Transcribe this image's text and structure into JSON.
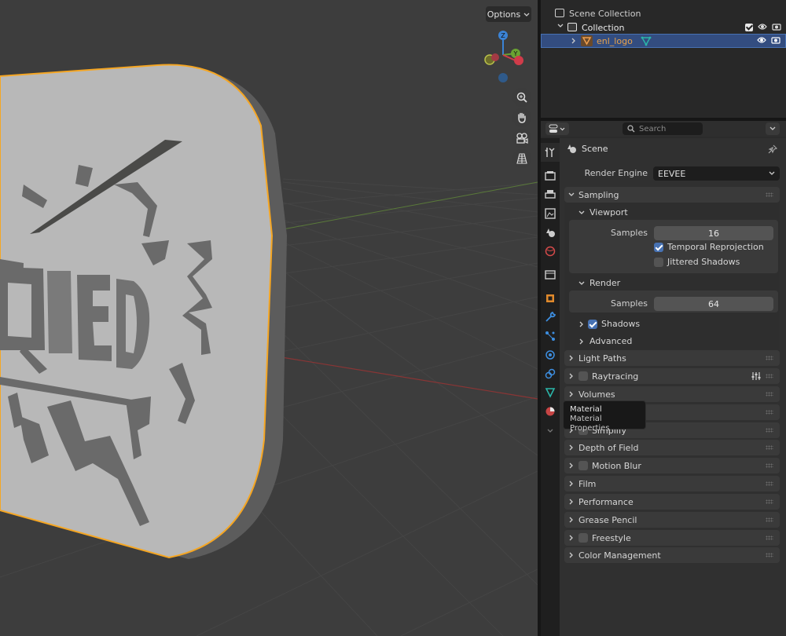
{
  "viewport": {
    "options_label": "Options",
    "gizmo_axes": [
      "Z",
      "Y"
    ],
    "logo_text": "IED",
    "nav_icons": [
      "zoom-icon",
      "hand-pan-icon",
      "camera-icon",
      "grid-icon"
    ]
  },
  "outliner": {
    "scene_collection": "Scene Collection",
    "collection": "Collection",
    "object": "enl_logo",
    "object_color": "#e8a24a"
  },
  "properties": {
    "search_placeholder": "Search",
    "context": "Scene",
    "render_engine_label": "Render Engine",
    "render_engine_value": "EEVEE",
    "sampling": {
      "title": "Sampling",
      "viewport": {
        "title": "Viewport",
        "samples_label": "Samples",
        "samples_value": "16",
        "temporal_reprojection": "Temporal Reprojection",
        "temporal_reprojection_checked": true,
        "jittered_shadows": "Jittered Shadows",
        "jittered_shadows_checked": false
      },
      "render": {
        "title": "Render",
        "samples_label": "Samples",
        "samples_value": "64"
      },
      "shadows": "Shadows",
      "shadows_checked": true,
      "advanced": "Advanced"
    },
    "panels": {
      "light_paths": "Light Paths",
      "raytracing": "Raytracing",
      "volumes": "Volumes",
      "simplify": "Simplify",
      "depth_of_field": "Depth of Field",
      "motion_blur": "Motion Blur",
      "film": "Film",
      "performance": "Performance",
      "grease_pencil": "Grease Pencil",
      "freestyle": "Freestyle",
      "color_management": "Color Management"
    },
    "tooltip": {
      "title": "Material",
      "subtitle": "Material Properties"
    }
  },
  "colors": {
    "selection": "#334d80",
    "accent_blue": "#4772b3",
    "object_outline": "#f5a623"
  }
}
